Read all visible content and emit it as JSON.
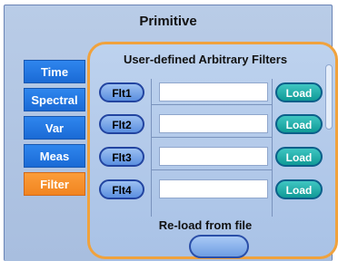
{
  "window": {
    "title": "Primitive"
  },
  "tabs": [
    {
      "label": "Time",
      "active": false
    },
    {
      "label": "Spectral",
      "active": false
    },
    {
      "label": "Var",
      "active": false
    },
    {
      "label": "Meas",
      "active": false
    },
    {
      "label": "Filter",
      "active": true
    }
  ],
  "panel": {
    "title": "User-defined Arbitrary Filters",
    "filters": [
      {
        "button": "Flt1",
        "path": "",
        "load_label": "Load"
      },
      {
        "button": "Flt2",
        "path": "",
        "load_label": "Load"
      },
      {
        "button": "Flt3",
        "path": "",
        "load_label": "Load"
      },
      {
        "button": "Flt4",
        "path": "",
        "load_label": "Load"
      }
    ],
    "reload_label": "Re-load from file"
  },
  "colors": {
    "tab_blue": "#2f86ee",
    "tab_active_orange": "#fb9d3a",
    "panel_border": "#f0a23d",
    "load_teal": "#1fb0ac"
  }
}
